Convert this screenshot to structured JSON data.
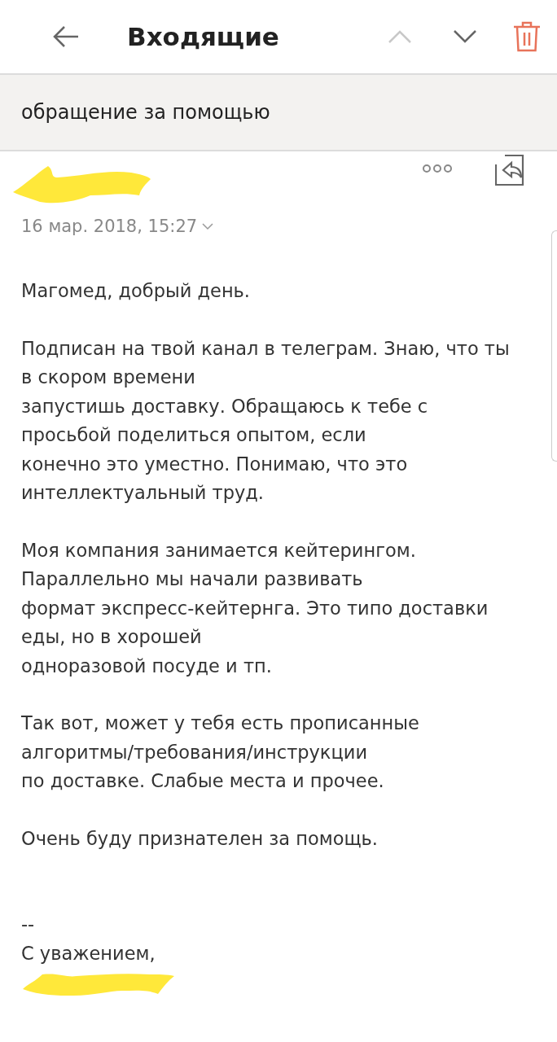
{
  "header": {
    "title": "Входящие"
  },
  "subject": "обращение за помощью",
  "message": {
    "date": "16 мар. 2018, 15:27",
    "paragraphs": [
      [
        "Магомед, добрый день."
      ],
      [
        "Подписан на твой канал в телеграм. Знаю, что ты",
        "в скором времени",
        "запустишь доставку. Обращаюсь к тебе с",
        "просьбой поделиться опытом, если",
        "конечно это уместно. Понимаю, что это",
        "интеллектуальный труд."
      ],
      [
        "Моя компания занимается кейтерингом.",
        "Параллельно мы начали развивать",
        "формат экспресс-кейтернга. Это типо доставки",
        "еды, но в хорошей",
        "одноразовой посуде и тп."
      ],
      [
        "Так вот, может у тебя есть прописанные",
        "алгоритмы/требования/инструкции",
        "по доставке. Слабые места и прочее."
      ],
      [
        "Очень буду признателен за помощь."
      ]
    ],
    "signature": [
      "--",
      "С уважением,"
    ]
  }
}
